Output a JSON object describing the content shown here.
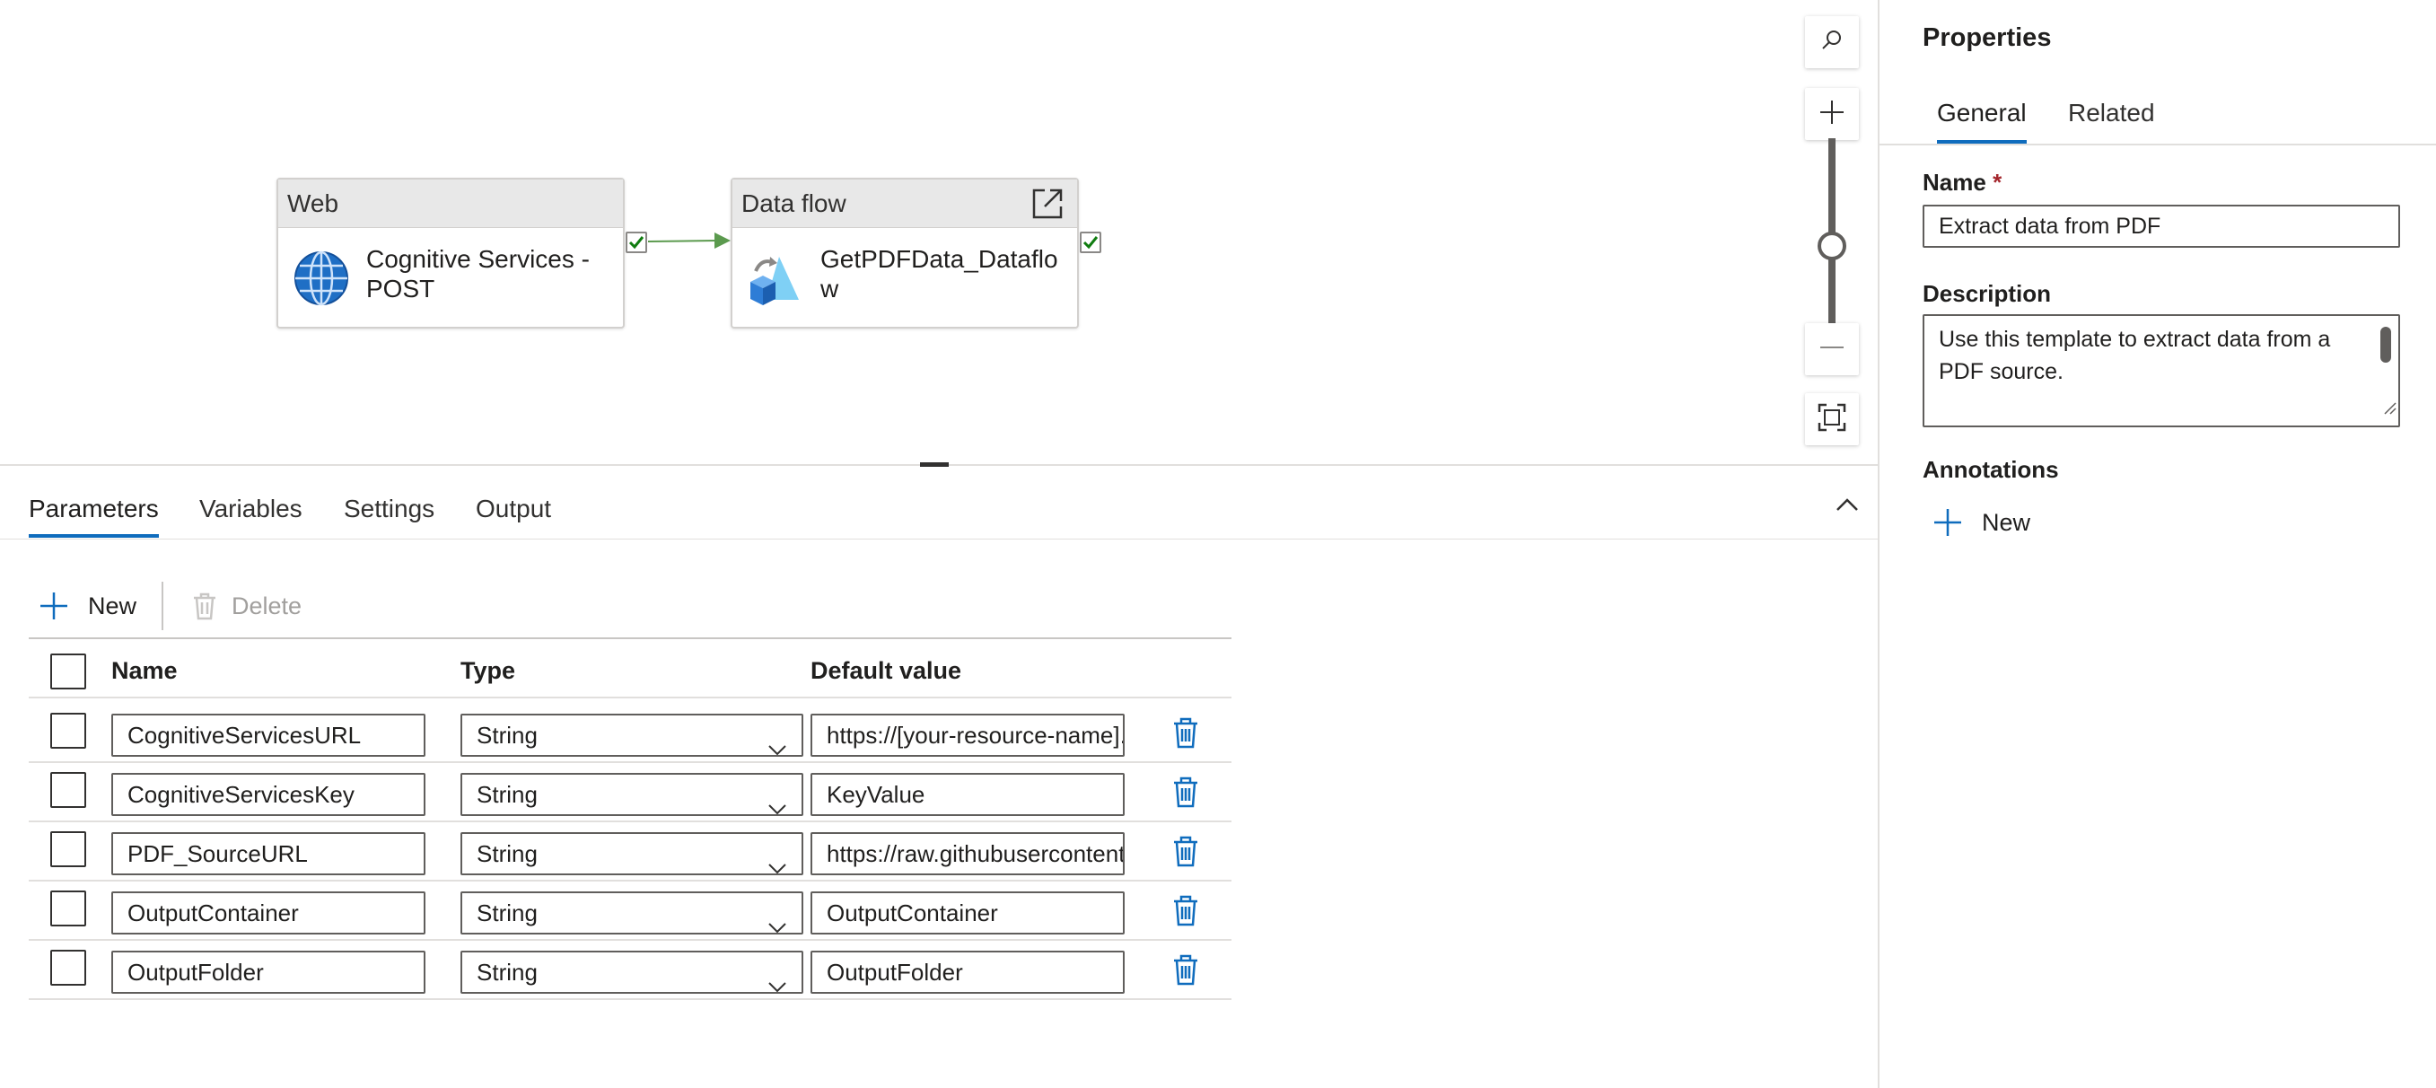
{
  "canvas": {
    "activities": [
      {
        "type_label": "Web",
        "name": "Cognitive Services - POST"
      },
      {
        "type_label": "Data flow",
        "name": "GetPDFData_Dataflow"
      }
    ]
  },
  "bottom_panel": {
    "tabs": [
      "Parameters",
      "Variables",
      "Settings",
      "Output"
    ],
    "active_tab": "Parameters",
    "toolbar": {
      "new_label": "New",
      "delete_label": "Delete"
    },
    "columns": {
      "name": "Name",
      "type": "Type",
      "default_value": "Default value"
    },
    "rows": [
      {
        "name": "CognitiveServicesURL",
        "type": "String",
        "default_value": "https://[your-resource-name].cognitiveservices.azure.com/"
      },
      {
        "name": "CognitiveServicesKey",
        "type": "String",
        "default_value": "KeyValue"
      },
      {
        "name": "PDF_SourceURL",
        "type": "String",
        "default_value": "https://raw.githubusercontent.com/"
      },
      {
        "name": "OutputContainer",
        "type": "String",
        "default_value": "OutputContainer"
      },
      {
        "name": "OutputFolder",
        "type": "String",
        "default_value": "OutputFolder"
      }
    ]
  },
  "properties": {
    "title": "Properties",
    "tabs": [
      "General",
      "Related"
    ],
    "active_tab": "General",
    "name_label": "Name",
    "required_mark": "*",
    "name_value": "Extract data from PDF",
    "description_label": "Description",
    "description_value": "Use this template to extract data from a PDF source.",
    "annotations_label": "Annotations",
    "annotations_new_label": "New"
  },
  "colors": {
    "accent": "#0f6cbd",
    "success_check": "#107c10",
    "connector": "#5b9a4e",
    "required": "#a4262c"
  },
  "icons": {
    "web_activity": "globe-icon",
    "dataflow_activity": "dataflow-icon",
    "open_in_new": "open-in-new-icon",
    "search": "search-icon",
    "zoom_in": "plus-icon",
    "zoom_out": "minus-icon",
    "fit": "fit-to-screen-icon",
    "collapse": "chevron-up-icon",
    "add": "plus-icon",
    "delete": "trash-icon"
  }
}
